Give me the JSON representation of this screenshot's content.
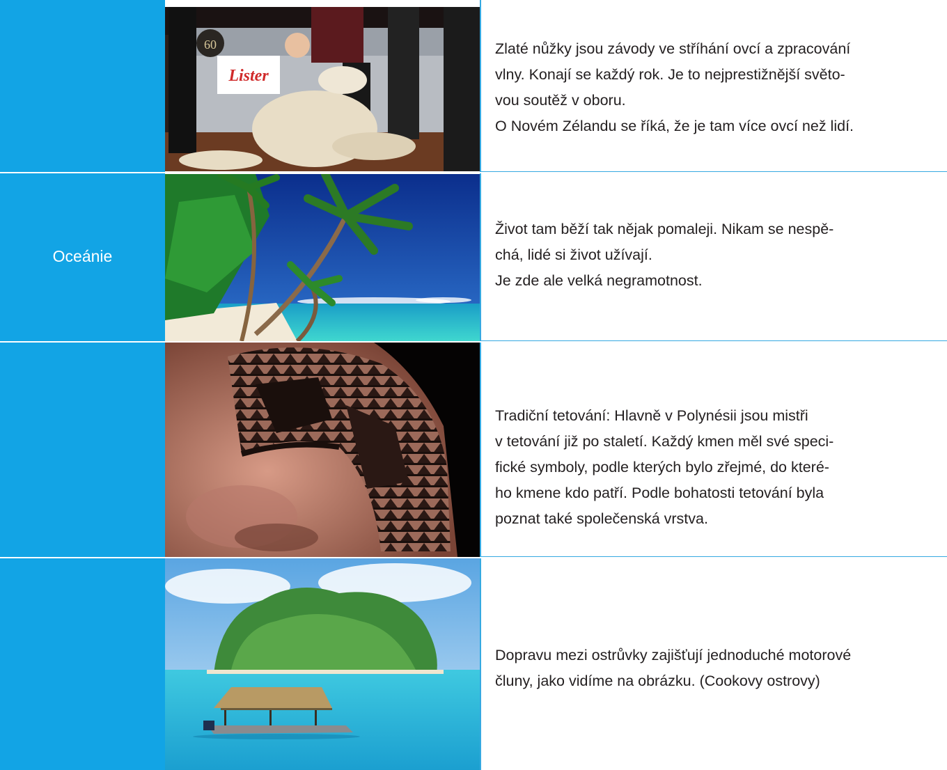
{
  "region": "Oceánie",
  "rows": [
    {
      "lines": [
        "Zlaté nůžky jsou závody ve stříhání ovcí a zpracování",
        "vlny. Konají se každý rok. Je to nejprestižnější světo-",
        "vou soutěž v oboru.",
        "O Novém Zélandu se říká, že je tam více ovcí než lidí."
      ]
    },
    {
      "lines": [
        "Život tam běží tak nějak pomaleji. Nikam se nespě-",
        "chá, lidé si život užívají.",
        "Je zde ale velká negramotnost."
      ]
    },
    {
      "lines": [
        "Tradiční tetování: Hlavně v Polynésii jsou mistři",
        "v tetování již po staletí. Každý kmen měl své speci-",
        "fické symboly, podle kterých bylo zřejmé, do které-",
        "ho kmene kdo patří. Podle bohatosti tetování byla",
        "poznat také společenská vrstva."
      ]
    },
    {
      "lines": [
        "Dopravu mezi ostrůvky zajišťují jednoduché motorové",
        "čluny, jako vidíme na obrázku. (Cookovy ostrovy)"
      ]
    }
  ],
  "images": {
    "photo1": {
      "sign_text": "Lister",
      "badge_text": "60"
    }
  }
}
